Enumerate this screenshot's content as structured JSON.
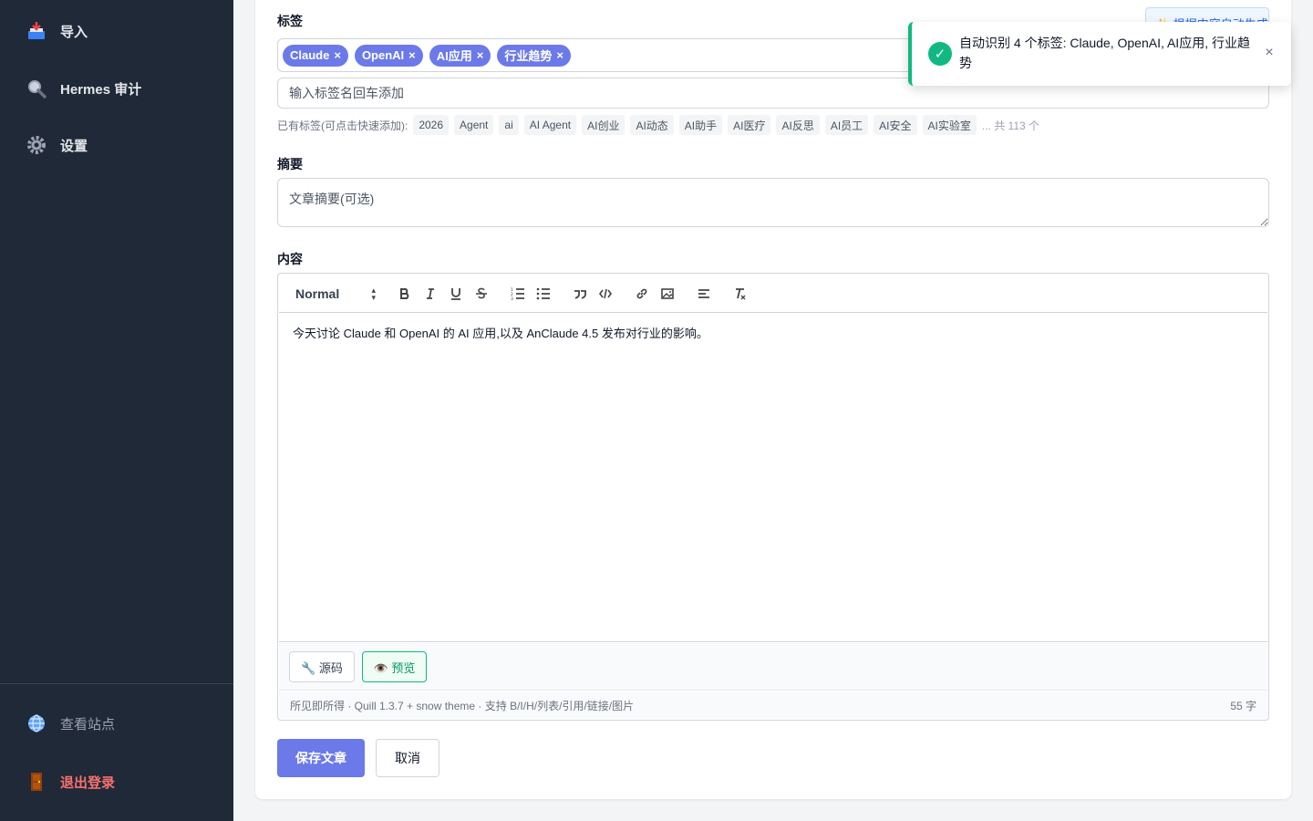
{
  "sidebar": {
    "items": [
      {
        "label": "导入",
        "icon": "inbox-tray-icon"
      },
      {
        "label": "Hermes 审计",
        "icon": "magnifier-icon"
      },
      {
        "label": "设置",
        "icon": "gear-icon"
      }
    ],
    "footer": [
      {
        "label": "查看站点",
        "icon": "globe-icon"
      },
      {
        "label": "退出登录",
        "icon": "door-icon"
      }
    ]
  },
  "form": {
    "tags_label": "标签",
    "auto_generate_label": "✨ 根据内容自动生成",
    "tags": [
      "Claude",
      "OpenAI",
      "AI应用",
      "行业趋势"
    ],
    "tag_remove_glyph": "×",
    "tag_input_placeholder": "输入标签名回车添加",
    "existing_label": "已有标签(可点击快速添加):",
    "existing_tags": [
      "2026",
      "Agent",
      "ai",
      "AI Agent",
      "AI创业",
      "AI动态",
      "AI助手",
      "AI医疗",
      "AI反思",
      "AI员工",
      "AI安全",
      "AI实验室"
    ],
    "existing_more": "... 共 113 个",
    "summary_label": "摘要",
    "summary_placeholder": "文章摘要(可选)",
    "content_label": "内容"
  },
  "editor": {
    "header_select": "Normal",
    "content_text": "今天讨论 Claude 和 OpenAI 的 AI 应用,以及 AnClaude 4.5 发布对行业的影响。",
    "source_button": "🔧 源码",
    "preview_button": "👁️ 预览",
    "status_left": "所见即所得 · Quill 1.3.7 + snow theme · 支持 B/I/H/列表/引用/链接/图片",
    "word_count": "55 字"
  },
  "actions": {
    "save": "保存文章",
    "cancel": "取消"
  },
  "toast": {
    "message": "自动识别 4 个标签: Claude, OpenAI, AI应用, 行业趋势",
    "close": "×"
  },
  "colors": {
    "sidebar_bg": "#1f2937",
    "primary": "#6b7ae8",
    "success": "#10b981",
    "danger": "#f87171"
  }
}
